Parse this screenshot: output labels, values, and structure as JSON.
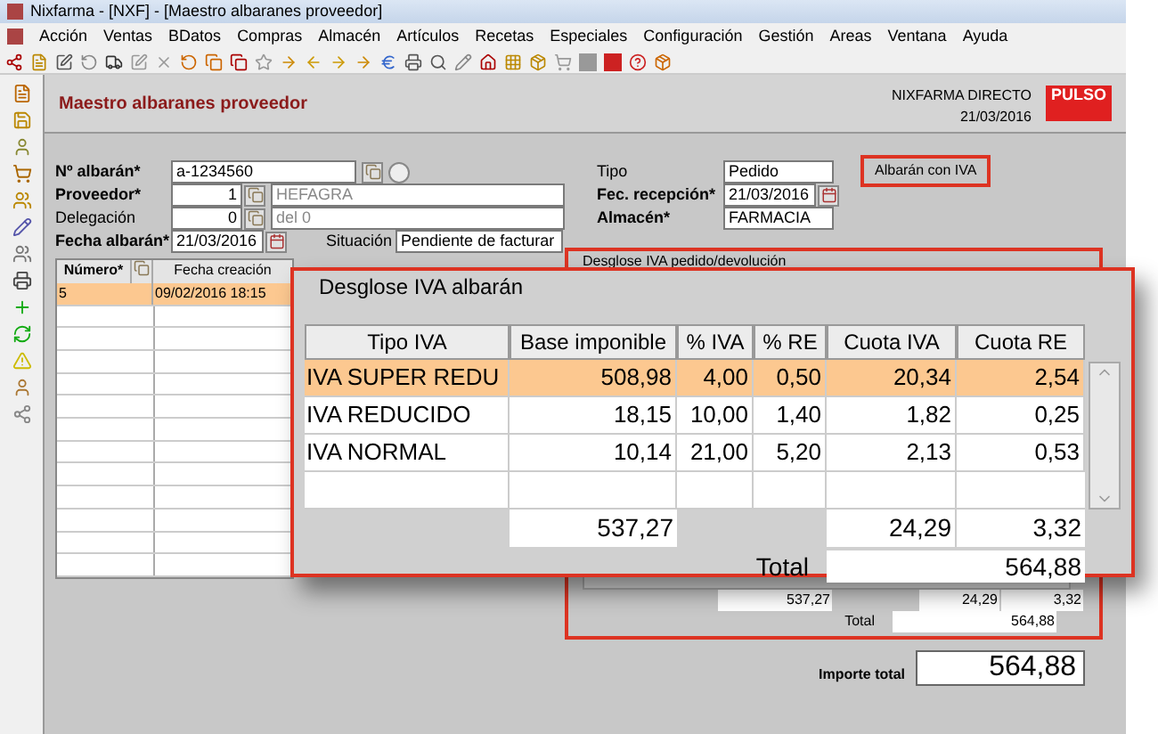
{
  "window": {
    "title": "Nixfarma - [NXF] - [Maestro albaranes proveedor]"
  },
  "menu": [
    "Acción",
    "Ventas",
    "BDatos",
    "Compras",
    "Almacén",
    "Artículos",
    "Recetas",
    "Especiales",
    "Configuración",
    "Gestión",
    "Areas",
    "Ventana",
    "Ayuda"
  ],
  "header": {
    "title": "Maestro albaranes proveedor",
    "company": "NIXFARMA DIRECTO",
    "date": "21/03/2016",
    "logo": "PULSO"
  },
  "form_left": [
    {
      "label": "Nº albarán*",
      "bold": true,
      "kind": "search",
      "value": "a-1234560"
    },
    {
      "label": "Proveedor*",
      "bold": true,
      "kind": "code",
      "value": "1",
      "name": "HEFAGRA"
    },
    {
      "label": "Delegación",
      "bold": false,
      "kind": "code",
      "value": "0",
      "name": "del 0"
    },
    {
      "label": "Fecha albarán*",
      "bold": true,
      "kind": "date",
      "value": "21/03/2016"
    }
  ],
  "situacion": {
    "label": "Situación",
    "value": "Pendiente de facturar"
  },
  "form_right": [
    {
      "label": "Tipo",
      "bold": false,
      "kind": "text",
      "value": "Pedido"
    },
    {
      "label": "Fec. recepción*",
      "bold": true,
      "kind": "date",
      "value": "21/03/2016"
    },
    {
      "label": "Almacén*",
      "bold": true,
      "kind": "text",
      "value": "FARMACIA"
    }
  ],
  "iva_badge": "Albarán con IVA",
  "albaranes": {
    "columns": [
      "Número*",
      "Fecha creación"
    ],
    "rows": [
      {
        "cells": [
          "5",
          "09/02/2016 18:15"
        ],
        "selected": true
      }
    ]
  },
  "pedido_panel": {
    "title": "Desglose IVA pedido/devolución",
    "base_total": "537,27",
    "cuota_iva_total": "24,29",
    "cuota_re_total": "3,32",
    "total_label": "Total",
    "total": "564,88"
  },
  "importe": {
    "label": "Importe total",
    "value": "564,88"
  },
  "popup": {
    "title": "Desglose IVA albarán",
    "columns": [
      "Tipo IVA",
      "Base imponible",
      "% IVA",
      "% RE",
      "Cuota IVA",
      "Cuota RE"
    ],
    "rows": [
      {
        "cells": [
          "IVA SUPER REDU",
          "508,98",
          "4,00",
          "0,50",
          "20,34",
          "2,54"
        ],
        "selected": true
      },
      {
        "cells": [
          "IVA REDUCIDO",
          "18,15",
          "10,00",
          "1,40",
          "1,82",
          "0,25"
        ],
        "selected": false
      },
      {
        "cells": [
          "IVA NORMAL",
          "10,14",
          "21,00",
          "5,20",
          "2,13",
          "0,53"
        ],
        "selected": false
      }
    ],
    "base_total": "537,27",
    "cuota_iva_total": "24,29",
    "cuota_re_total": "3,32",
    "total_label": "Total",
    "total": "564,88"
  }
}
